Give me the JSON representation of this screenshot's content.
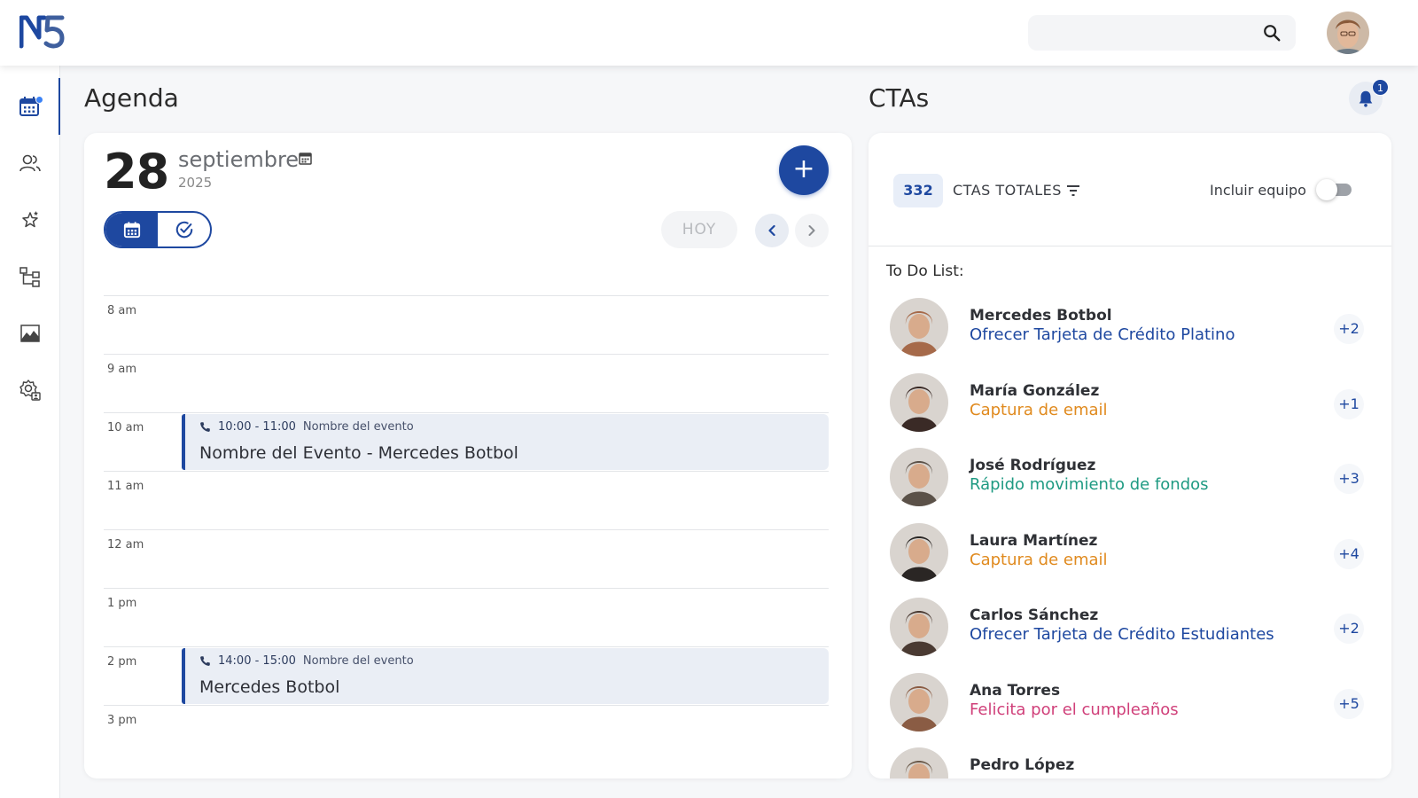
{
  "brand": {
    "logo_text": "N5",
    "accent": "#1e48a0"
  },
  "search": {
    "placeholder": "",
    "icon": "search-icon"
  },
  "sidebar": {
    "items": [
      {
        "name": "calendar",
        "icon": "calendar-icon",
        "active": true,
        "notification": true
      },
      {
        "name": "contacts",
        "icon": "users-icon",
        "active": false
      },
      {
        "name": "favorites",
        "icon": "stars-icon",
        "active": false
      },
      {
        "name": "hierarchy",
        "icon": "hierarchy-icon",
        "active": false
      },
      {
        "name": "reports",
        "icon": "chart-area-icon",
        "active": false
      },
      {
        "name": "settings",
        "icon": "settings-user-icon",
        "active": false
      }
    ]
  },
  "agenda": {
    "heading": "Agenda",
    "day": "28",
    "month": "septiembre",
    "year": "2025",
    "today_label": "HOY",
    "add_label": "+",
    "slots": [
      "8 am",
      "9 am",
      "10 am",
      "11 am",
      "12 am",
      "1 pm",
      "2 pm",
      "3 pm"
    ],
    "events": [
      {
        "slot_index": 2,
        "time": "10:00 - 11:00",
        "subtitle": "Nombre del evento",
        "title": "Nombre del Evento - Mercedes Botbol"
      },
      {
        "slot_index": 6,
        "time": "14:00 - 15:00",
        "subtitle": "Nombre del evento",
        "title": "Mercedes Botbol"
      }
    ]
  },
  "ctas": {
    "heading": "CTAs",
    "notifications_count": "1",
    "total_count": "332",
    "total_label": "CTAS TOTALES",
    "include_team_label": "Incluir equipo",
    "include_team_on": false,
    "todo_title": "To Do List:",
    "items": [
      {
        "name": "Mercedes Botbol",
        "action": "Ofrecer Tarjeta de Crédito Platino",
        "action_color": "#1e48a0",
        "count": "+2",
        "avatar_bg": "#a66a4a"
      },
      {
        "name": "María González",
        "action": "Captura de email",
        "action_color": "#e08a1e",
        "count": "+1",
        "avatar_bg": "#3a2a26"
      },
      {
        "name": "José Rodríguez",
        "action": "Rápido movimiento de fondos",
        "action_color": "#1e9a82",
        "count": "+3",
        "avatar_bg": "#5b5148"
      },
      {
        "name": "Laura Martínez",
        "action": "Captura de email",
        "action_color": "#e08a1e",
        "count": "+4",
        "avatar_bg": "#2a2624"
      },
      {
        "name": "Carlos Sánchez",
        "action": "Ofrecer Tarjeta de Crédito Estudiantes",
        "action_color": "#1e48a0",
        "count": "+2",
        "avatar_bg": "#4a3a32"
      },
      {
        "name": "Ana Torres",
        "action": "Felicita por el cumpleaños",
        "action_color": "#d0407a",
        "count": "+5",
        "avatar_bg": "#8a5c44"
      },
      {
        "name": "Pedro López",
        "action": "",
        "action_color": "#1e48a0",
        "count": "",
        "avatar_bg": "#6b5a4a"
      }
    ]
  }
}
